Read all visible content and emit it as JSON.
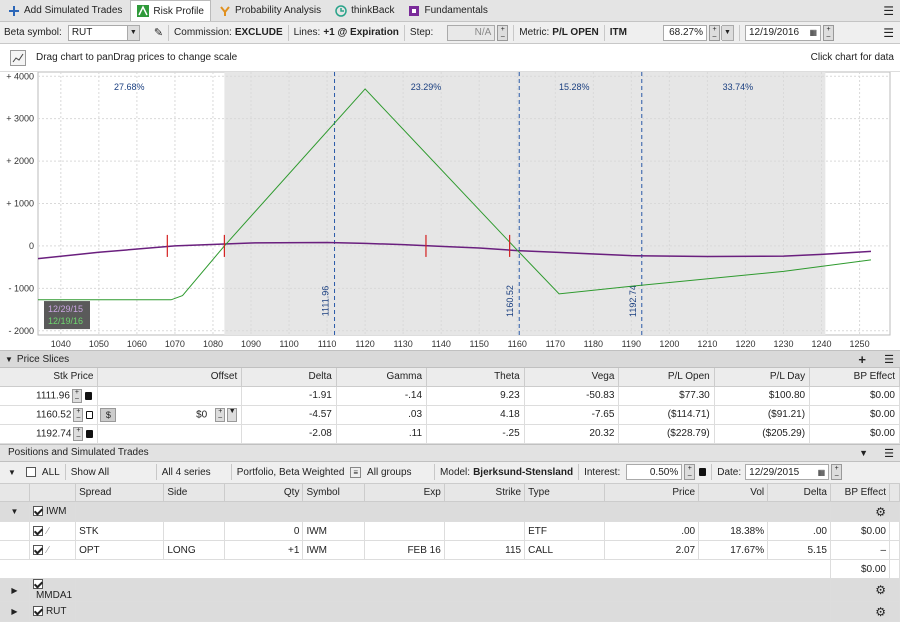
{
  "tabs": [
    {
      "label": "Add Simulated Trades",
      "icon": "plus-icon",
      "color": "#2b66b8"
    },
    {
      "label": "Risk Profile",
      "icon": "risk-profile-icon",
      "color": "#2f9a3a",
      "active": true
    },
    {
      "label": "Probability Analysis",
      "icon": "probability-icon",
      "color": "#e0901e"
    },
    {
      "label": "thinkBack",
      "icon": "thinkback-icon",
      "color": "#2aa38a"
    },
    {
      "label": "Fundamentals",
      "icon": "fundamentals-icon",
      "color": "#7a2b9a"
    }
  ],
  "toolbar": {
    "beta_label": "Beta symbol:",
    "beta_value": "RUT",
    "commission_label": "Commission:",
    "commission_value": "EXCLUDE",
    "lines_label": "Lines:",
    "lines_value": "+1 @ Expiration",
    "step_label": "Step:",
    "step_value": "N/A",
    "metric_label": "Metric:",
    "metric_value": "P/L OPEN",
    "itm_label": "ITM",
    "itm_value": "68.27%",
    "date_value": "12/19/2016"
  },
  "info": {
    "drag_text": "Drag chart to panDrag prices to change scale",
    "click_text": "Click chart for data"
  },
  "chart_data": {
    "type": "line",
    "xlim": [
      1034,
      1258
    ],
    "ylim": [
      -2100,
      4100
    ],
    "xticks": [
      1040,
      1050,
      1060,
      1070,
      1080,
      1090,
      1100,
      1110,
      1120,
      1130,
      1140,
      1150,
      1160,
      1170,
      1180,
      1190,
      1200,
      1210,
      1220,
      1230,
      1240,
      1250
    ],
    "yticks": [
      {
        "v": 4000,
        "t": "+ 4000"
      },
      {
        "v": 3000,
        "t": "+ 3000"
      },
      {
        "v": 2000,
        "t": "+ 2000"
      },
      {
        "v": 1000,
        "t": "+ 1000"
      },
      {
        "v": 0,
        "t": "0"
      },
      {
        "v": -1000,
        "t": "- 1000"
      },
      {
        "v": -2000,
        "t": "- 2000"
      }
    ],
    "shaded_range": [
      1083,
      1241
    ],
    "probabilities": [
      {
        "x": 1058,
        "label": "27.68%"
      },
      {
        "x": 1136,
        "label": "23.29%"
      },
      {
        "x": 1175,
        "label": "15.28%"
      },
      {
        "x": 1218,
        "label": "33.74%"
      }
    ],
    "slices": [
      {
        "x": 1111.96,
        "label": "1111.96"
      },
      {
        "x": 1160.52,
        "label": "1160.52"
      },
      {
        "x": 1192.74,
        "label": "1192.74"
      }
    ],
    "series": [
      {
        "color": "#6a1f7e",
        "x": [
          1034,
          1050,
          1070,
          1090,
          1110,
          1120,
          1130,
          1140,
          1150,
          1160,
          1170,
          1190,
          1210,
          1230,
          1240,
          1253
        ],
        "y": [
          -300,
          -150,
          0,
          70,
          80,
          60,
          30,
          -10,
          -50,
          -110,
          -150,
          -230,
          -250,
          -240,
          -200,
          -130
        ]
      },
      {
        "color": "#2e9a2e",
        "x": [
          1034,
          1069,
          1072,
          1083,
          1120,
          1160,
          1171,
          1190,
          1230,
          1253
        ],
        "y": [
          -1270,
          -1270,
          -1170,
          0,
          3700,
          -100,
          -1130,
          -950,
          -600,
          -330
        ]
      }
    ],
    "breakevens": [
      1068,
      1083,
      1136,
      1158
    ],
    "legend": [
      {
        "label": "12/29/15",
        "color": "#6a1f7e"
      },
      {
        "label": "12/19/16",
        "color": "#2e9a2e"
      }
    ]
  },
  "price_slices": {
    "title": "Price Slices",
    "headers": [
      "Stk Price",
      "Offset",
      "Delta",
      "Gamma",
      "Theta",
      "Vega",
      "P/L Open",
      "P/L Day",
      "BP Effect"
    ],
    "rows": [
      {
        "price": "1111.96",
        "offset": "",
        "delta": "-1.91",
        "gamma": "-.14",
        "theta": "9.23",
        "vega": "-50.83",
        "pl_open": "$77.30",
        "pl_day": "$100.80",
        "bp": "$0.00"
      },
      {
        "price": "1160.52",
        "offset": "$0",
        "delta": "-4.57",
        "gamma": ".03",
        "theta": "4.18",
        "vega": "-7.65",
        "pl_open": "($114.71)",
        "pl_day": "($91.21)",
        "bp": "$0.00"
      },
      {
        "price": "1192.74",
        "offset": "",
        "delta": "-2.08",
        "gamma": ".11",
        "theta": "-.25",
        "vega": "20.32",
        "pl_open": "($228.79)",
        "pl_day": "($205.29)",
        "bp": "$0.00"
      }
    ]
  },
  "positions": {
    "title": "Positions and Simulated Trades",
    "filter": {
      "all": "ALL",
      "show": "Show All",
      "series": "All 4 series",
      "weight": "Portfolio, Beta Weighted",
      "groups": "All groups",
      "model_label": "Model:",
      "model": "Bjerksund-Stensland",
      "interest_label": "Interest:",
      "interest": "0.50%",
      "date_label": "Date:",
      "date": "12/29/2015"
    },
    "headers": [
      "Spread",
      "Side",
      "Qty",
      "Symbol",
      "Exp",
      "Strike",
      "Type",
      "Price",
      "Vol",
      "Delta",
      "BP Effect"
    ],
    "groups": [
      {
        "name": "IWM",
        "rows": [
          {
            "spread": "STK",
            "side": "",
            "qty": "0",
            "symbol": "IWM",
            "exp": "",
            "strike": "",
            "type": "ETF",
            "price": ".00",
            "vol": "18.38%",
            "delta": ".00",
            "bp": "$0.00"
          },
          {
            "spread": "OPT",
            "side": "LONG",
            "qty": "+1",
            "symbol": "IWM",
            "exp": "FEB 16",
            "strike": "115",
            "type": "CALL",
            "price": "2.07",
            "vol": "17.67%",
            "delta": "5.15",
            "bp": "–"
          }
        ],
        "total_bp": "$0.00"
      },
      {
        "name": "MMDA1"
      },
      {
        "name": "RUT"
      }
    ]
  }
}
